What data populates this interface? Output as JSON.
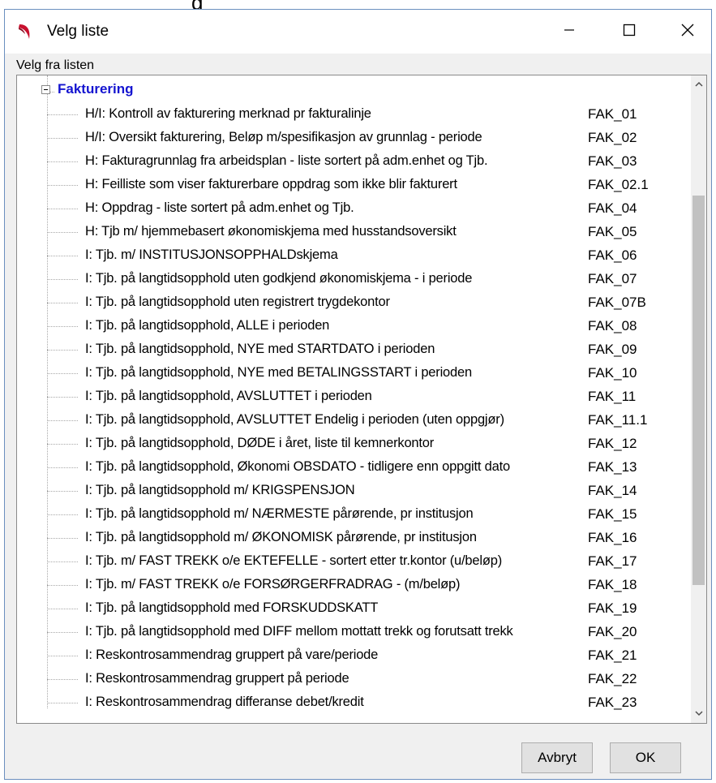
{
  "top_fragment": "g",
  "window": {
    "title": "Velg liste"
  },
  "section_label": "Velg fra listen",
  "tree": {
    "group_label": "Fakturering",
    "items": [
      {
        "label": "H/I: Kontroll av fakturering  merknad pr fakturalinje",
        "code": "FAK_01"
      },
      {
        "label": "H/I: Oversikt fakturering, Beløp m/spesifikasjon av grunnlag -  periode",
        "code": "FAK_02"
      },
      {
        "label": "H: Fakturagrunnlag fra arbeidsplan - liste sortert på adm.enhet og Tjb.",
        "code": "FAK_03"
      },
      {
        "label": "H: Feilliste som viser fakturerbare oppdrag som ikke blir fakturert",
        "code": "FAK_02.1"
      },
      {
        "label": "H: Oppdrag -  liste sortert på adm.enhet og Tjb.",
        "code": "FAK_04"
      },
      {
        "label": "H: Tjb m/ hjemmebasert økonomiskjema med husstandsoversikt",
        "code": "FAK_05"
      },
      {
        "label": "I: Tjb. m/ INSTITUSJONSOPPHALDskjema",
        "code": "FAK_06"
      },
      {
        "label": "I: Tjb. på langtidsopphold uten godkjend økonomiskjema -  i periode",
        "code": "FAK_07"
      },
      {
        "label": "I: Tjb. på langtidsopphold uten registrert trygdekontor",
        "code": "FAK_07B"
      },
      {
        "label": "I: Tjb. på langtidsopphold,  ALLE i perioden",
        "code": "FAK_08"
      },
      {
        "label": "I: Tjb. på langtidsopphold,  NYE med STARTDATO i perioden",
        "code": "FAK_09"
      },
      {
        "label": "I: Tjb. på langtidsopphold,  NYE med BETALINGSSTART i perioden",
        "code": "FAK_10"
      },
      {
        "label": "I: Tjb. på langtidsopphold,  AVSLUTTET i perioden",
        "code": "FAK_11"
      },
      {
        "label": "I: Tjb. på langtidsopphold,  AVSLUTTET Endelig i perioden (uten oppgjør)",
        "code": "FAK_11.1"
      },
      {
        "label": "I: Tjb. på langtidsopphold,  DØDE i året, liste til kemnerkontor",
        "code": "FAK_12"
      },
      {
        "label": "I: Tjb. på langtidsopphold,  Økonomi OBSDATO - tidligere enn oppgitt dato",
        "code": "FAK_13"
      },
      {
        "label": "I: Tjb. på langtidsopphold   m/ KRIGSPENSJON",
        "code": "FAK_14"
      },
      {
        "label": "I: Tjb. på langtidsopphold   m/ NÆRMESTE pårørende, pr institusjon",
        "code": "FAK_15"
      },
      {
        "label": "I: Tjb. på langtidsopphold  m/ ØKONOMISK pårørende, pr institusjon",
        "code": "FAK_16"
      },
      {
        "label": "I: Tjb. m/ FAST TREKK o/e EKTEFELLE - sortert etter tr.kontor (u/beløp)",
        "code": "FAK_17"
      },
      {
        "label": "I: Tjb. m/ FAST TREKK o/e FORSØRGERFRADRAG -  (m/beløp)",
        "code": "FAK_18"
      },
      {
        "label": "I: Tjb. på langtidsopphold med FORSKUDDSKATT",
        "code": "FAK_19"
      },
      {
        "label": "I: Tjb. på langtidsopphold med DIFF mellom mottatt trekk og forutsatt trekk",
        "code": "FAK_20"
      },
      {
        "label": "I: Reskontrosammendrag gruppert på vare/periode",
        "code": "FAK_21"
      },
      {
        "label": "I: Reskontrosammendrag gruppert på periode",
        "code": "FAK_22"
      },
      {
        "label": "I: Reskontrosammendrag differanse debet/kredit",
        "code": "FAK_23"
      }
    ]
  },
  "buttons": {
    "cancel": "Avbryt",
    "ok": "OK"
  },
  "icons": {
    "app": "app-logo-icon",
    "minimize": "minimize-icon",
    "maximize": "maximize-icon",
    "close": "close-icon",
    "collapse": "collapse-minus-icon",
    "scroll_up": "chevron-up-icon",
    "scroll_down": "chevron-down-icon"
  },
  "colors": {
    "group_label": "#1414d0",
    "title_bar": "#ffffff",
    "dialog_bg": "#f0f0f0",
    "logo": "#c8102e"
  }
}
